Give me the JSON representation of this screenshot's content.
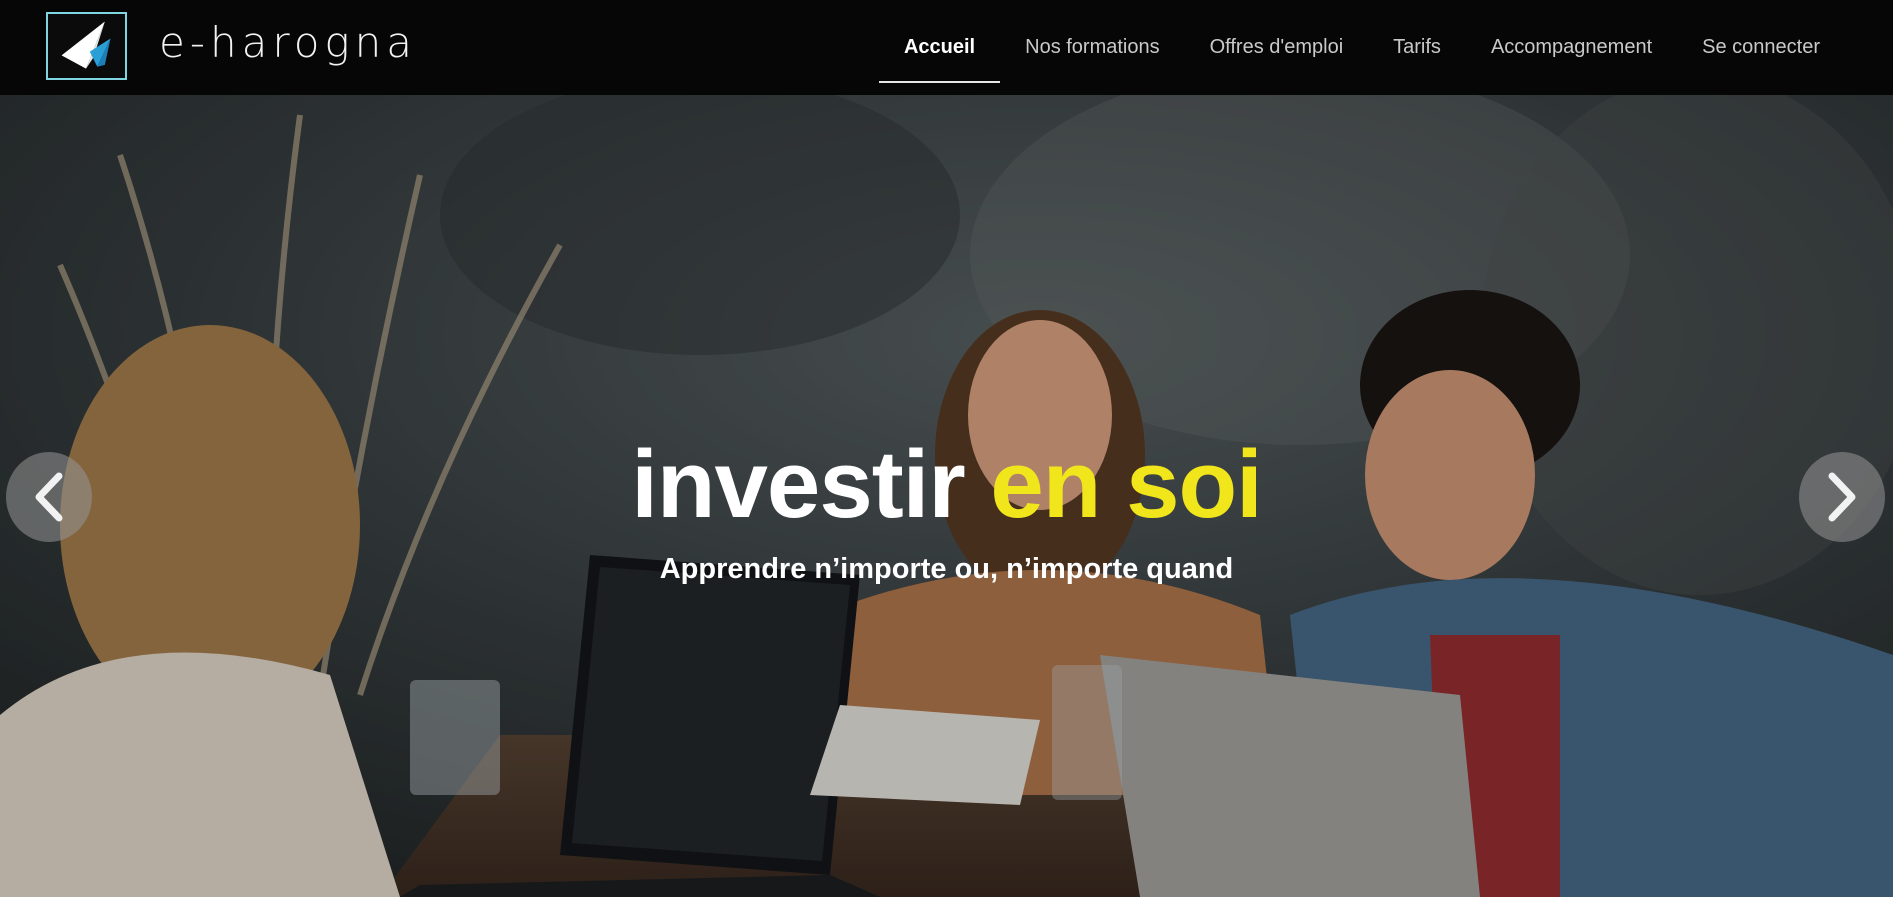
{
  "brand": {
    "logo_icon": "paper-plane-icon",
    "name": "e-harogna",
    "accent_color": "#7fd6e0"
  },
  "nav": {
    "items": [
      {
        "label": "Accueil",
        "active": true
      },
      {
        "label": "Nos formations",
        "active": false
      },
      {
        "label": "Offres d'emploi",
        "active": false
      },
      {
        "label": "Tarifs",
        "active": false
      },
      {
        "label": "Accompagnement",
        "active": false
      },
      {
        "label": "Se connecter",
        "active": false
      }
    ]
  },
  "hero": {
    "headline_part1": "investir",
    "headline_part2": "en soi",
    "headline_accent_color": "#f1e61b",
    "subheadline": "Apprendre n’importe ou, n’importe quand",
    "prev_icon": "chevron-left-icon",
    "next_icon": "chevron-right-icon"
  }
}
